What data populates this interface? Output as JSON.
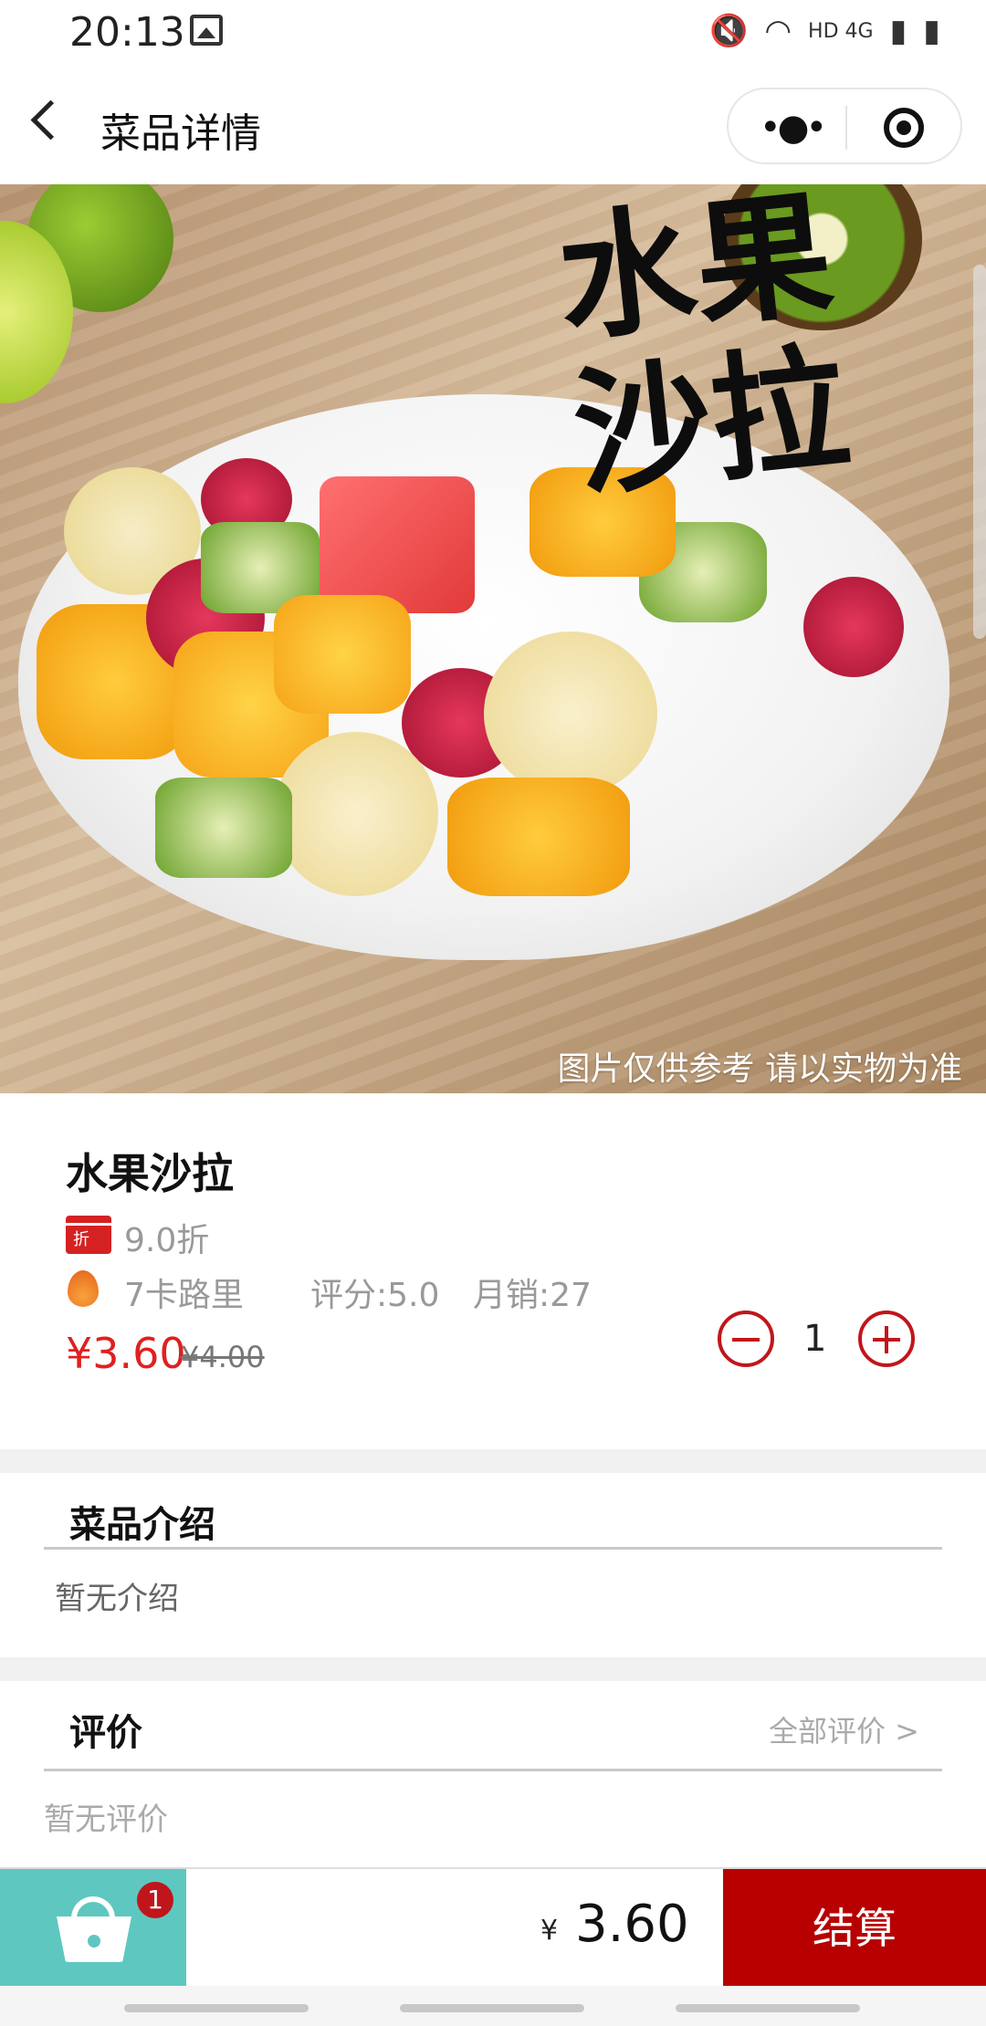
{
  "status_bar": {
    "time": "20:13",
    "indicators": "HD 4G"
  },
  "nav": {
    "title": "菜品详情"
  },
  "hero": {
    "calligraphy": "水果沙拉",
    "caption": "图片仅供参考 请以实物为准"
  },
  "dish": {
    "name": "水果沙拉",
    "discount_badge": "折",
    "discount": "9.0折",
    "calories": "7卡路里",
    "rating": "评分:5.0",
    "monthly_sales": "月销:27",
    "price": "¥3.60",
    "original_price": "¥4.00",
    "quantity": "1"
  },
  "intro": {
    "title": "菜品介绍",
    "text": "暂无介绍"
  },
  "reviews": {
    "title": "评价",
    "all_link": "全部评价 >",
    "empty": "暂无评价"
  },
  "cart": {
    "badge_count": "1",
    "currency": "¥",
    "total": "3.60",
    "checkout_label": "结算"
  },
  "colors": {
    "accent": "#c0161b",
    "cart_bg": "#5ec7c0",
    "checkout_bg": "#b80000",
    "price": "#e02020"
  }
}
